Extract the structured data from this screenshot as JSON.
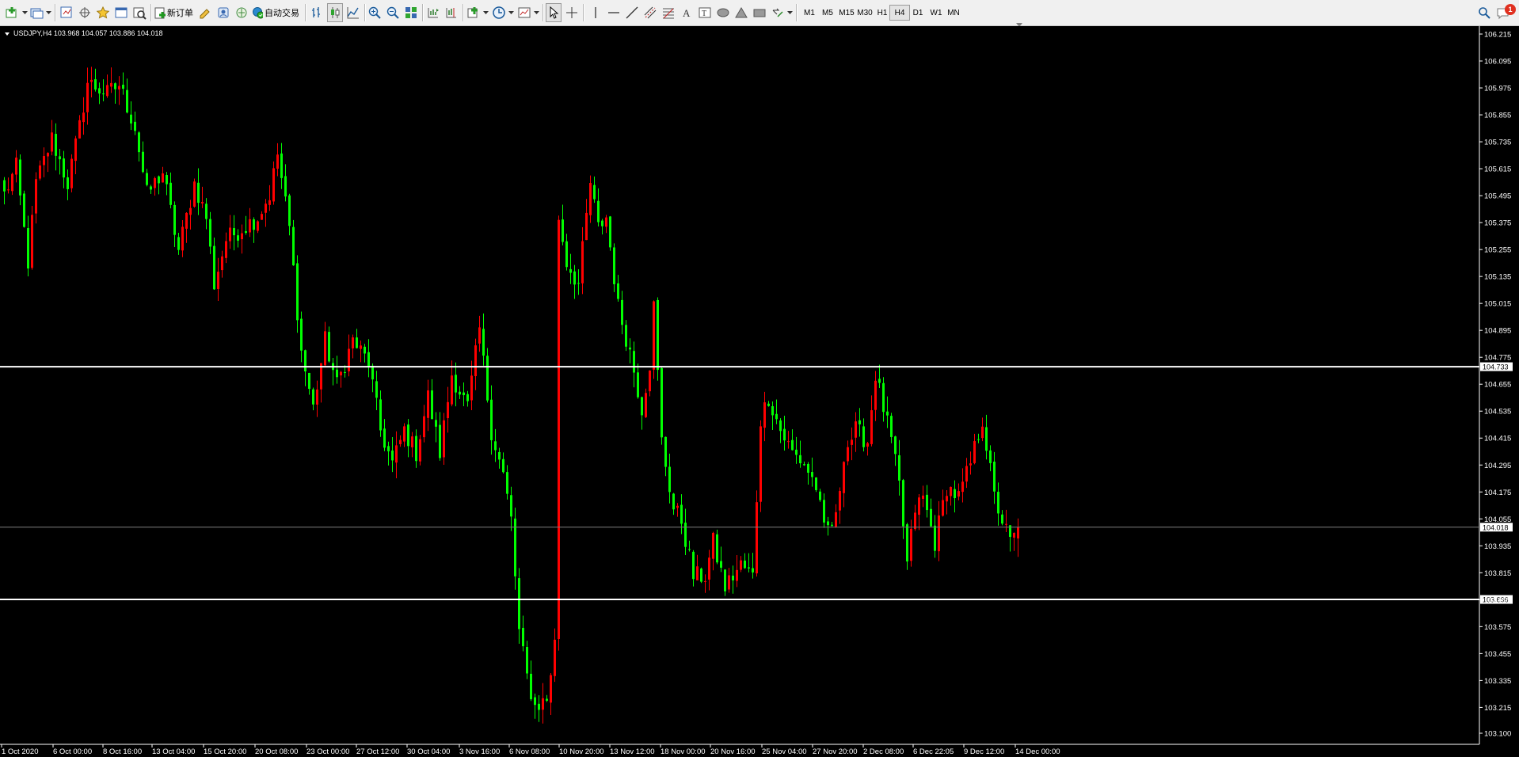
{
  "toolbar": {
    "new_order_label": "新订单",
    "auto_trade_label": "自动交易",
    "timeframes": [
      "M1",
      "M5",
      "M15",
      "M30",
      "H1",
      "H4",
      "D1",
      "W1",
      "MN"
    ],
    "active_timeframe": "H4",
    "notification_count": "1"
  },
  "chart": {
    "header_text": "USDJPY,H4  103.968 104.057 103.886 104.018",
    "current_price_tag": "104.018",
    "hline_upper_tag": "104.733",
    "hline_lower_tag": "103.696",
    "colors": {
      "background": "#000000",
      "bull": "#ff0000",
      "bear": "#00ff00",
      "axis": "#ffffff",
      "hline": "#ffffff",
      "grid_current": "#808080"
    }
  },
  "chart_data": {
    "type": "candlestick",
    "symbol": "USDJPY",
    "timeframe": "H4",
    "ohlc_last": {
      "open": 103.968,
      "high": 104.057,
      "low": 103.886,
      "close": 104.018
    },
    "y_ticks": [
      "106.215",
      "106.095",
      "105.975",
      "105.855",
      "105.735",
      "105.615",
      "105.495",
      "105.375",
      "105.255",
      "105.135",
      "105.015",
      "104.895",
      "104.775",
      "104.655",
      "104.535",
      "104.415",
      "104.295",
      "104.175",
      "104.055",
      "103.935",
      "103.815",
      "103.695",
      "103.575",
      "103.455",
      "103.335",
      "103.215",
      "103.100"
    ],
    "ylim": [
      103.1,
      106.25
    ],
    "x_ticks": [
      "1 Oct 2020",
      "6 Oct 00:00",
      "8 Oct 16:00",
      "13 Oct 04:00",
      "15 Oct 20:00",
      "20 Oct 08:00",
      "23 Oct 00:00",
      "27 Oct 12:00",
      "30 Oct 04:00",
      "3 Nov 16:00",
      "6 Nov 08:00",
      "10 Nov 20:00",
      "13 Nov 12:00",
      "18 Nov 00:00",
      "20 Nov 16:00",
      "25 Nov 04:00",
      "27 Nov 20:00",
      "2 Dec 08:00",
      "6 Dec 22:05",
      "9 Dec 12:00",
      "14 Dec 00:00"
    ],
    "horizontal_lines": [
      104.733,
      103.696
    ],
    "current_price": 104.018,
    "anchors": [
      [
        0,
        105.5
      ],
      [
        3,
        105.62
      ],
      [
        6,
        105.2
      ],
      [
        8,
        105.55
      ],
      [
        12,
        105.75
      ],
      [
        16,
        105.55
      ],
      [
        19,
        105.8
      ],
      [
        21,
        106.0
      ],
      [
        26,
        105.95
      ],
      [
        29,
        105.99
      ],
      [
        33,
        105.8
      ],
      [
        36,
        105.5
      ],
      [
        40,
        105.6
      ],
      [
        44,
        105.25
      ],
      [
        48,
        105.55
      ],
      [
        51,
        105.4
      ],
      [
        53,
        105.1
      ],
      [
        56,
        105.3
      ],
      [
        60,
        105.35
      ],
      [
        64,
        105.4
      ],
      [
        67,
        105.5
      ],
      [
        69,
        105.68
      ],
      [
        72,
        105.35
      ],
      [
        75,
        104.8
      ],
      [
        78,
        104.55
      ],
      [
        81,
        104.85
      ],
      [
        84,
        104.65
      ],
      [
        88,
        104.85
      ],
      [
        92,
        104.75
      ],
      [
        95,
        104.45
      ],
      [
        98,
        104.3
      ],
      [
        101,
        104.45
      ],
      [
        104,
        104.35
      ],
      [
        107,
        104.6
      ],
      [
        110,
        104.35
      ],
      [
        113,
        104.7
      ],
      [
        117,
        104.55
      ],
      [
        120,
        104.9
      ],
      [
        123,
        104.45
      ],
      [
        126,
        104.25
      ],
      [
        128,
        104.05
      ],
      [
        130,
        103.55
      ],
      [
        132,
        103.35
      ],
      [
        134,
        103.22
      ],
      [
        137,
        103.25
      ],
      [
        139,
        103.5
      ],
      [
        140,
        105.4
      ],
      [
        142,
        105.2
      ],
      [
        145,
        105.1
      ],
      [
        148,
        105.55
      ],
      [
        150,
        105.35
      ],
      [
        152,
        105.4
      ],
      [
        155,
        105.0
      ],
      [
        158,
        104.8
      ],
      [
        161,
        104.55
      ],
      [
        163,
        104.75
      ],
      [
        164,
        105.0
      ],
      [
        166,
        104.4
      ],
      [
        169,
        104.1
      ],
      [
        171,
        104.05
      ],
      [
        174,
        103.8
      ],
      [
        177,
        103.8
      ],
      [
        179,
        103.95
      ],
      [
        182,
        103.75
      ],
      [
        186,
        103.85
      ],
      [
        189,
        103.8
      ],
      [
        191,
        104.5
      ],
      [
        193,
        104.6
      ],
      [
        196,
        104.45
      ],
      [
        199,
        104.35
      ],
      [
        202,
        104.3
      ],
      [
        205,
        104.2
      ],
      [
        207,
        104.0
      ],
      [
        210,
        104.05
      ],
      [
        212,
        104.35
      ],
      [
        215,
        104.45
      ],
      [
        218,
        104.4
      ],
      [
        220,
        104.7
      ],
      [
        222,
        104.55
      ],
      [
        224,
        104.4
      ],
      [
        226,
        104.2
      ],
      [
        228,
        103.85
      ],
      [
        230,
        104.1
      ],
      [
        232,
        104.15
      ],
      [
        235,
        103.95
      ],
      [
        238,
        104.2
      ],
      [
        241,
        104.15
      ],
      [
        244,
        104.3
      ],
      [
        247,
        104.5
      ],
      [
        250,
        104.15
      ],
      [
        252,
        104.05
      ],
      [
        254,
        103.95
      ],
      [
        256,
        104.0
      ]
    ]
  }
}
